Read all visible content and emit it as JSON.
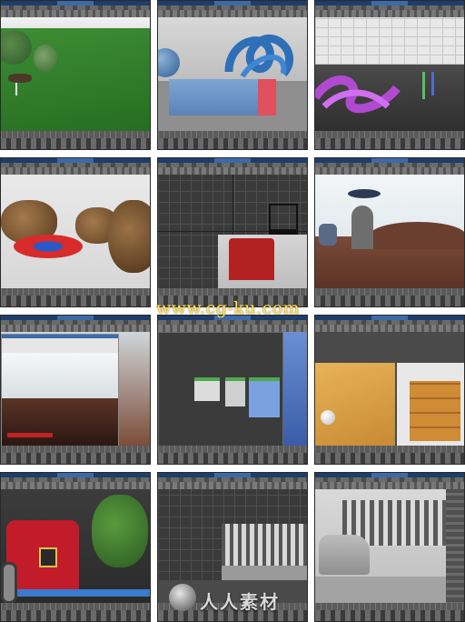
{
  "watermark": {
    "text": "www.cg-ku.com"
  },
  "logo": {
    "text": "人人素材",
    "icon": "sphere-logo-icon"
  },
  "grid": {
    "columns": 3,
    "rows": 4,
    "cells": [
      {
        "name": "trees-grass-scene"
      },
      {
        "name": "knot-box-scene"
      },
      {
        "name": "curve-editor-scene"
      },
      {
        "name": "trees-fountain-scene"
      },
      {
        "name": "chair-wireframe-scene"
      },
      {
        "name": "desert-landscape-scene"
      },
      {
        "name": "render-dialog-scene"
      },
      {
        "name": "material-editor-scene"
      },
      {
        "name": "wood-dresser-scene"
      },
      {
        "name": "cartoon-house-scene"
      },
      {
        "name": "city-wireframe-scene"
      },
      {
        "name": "street-car-scene"
      }
    ]
  },
  "colors": {
    "ui_dark": "#3f3f3f",
    "title_blue": "#1d3e6b",
    "watermark": "#ffe066"
  }
}
